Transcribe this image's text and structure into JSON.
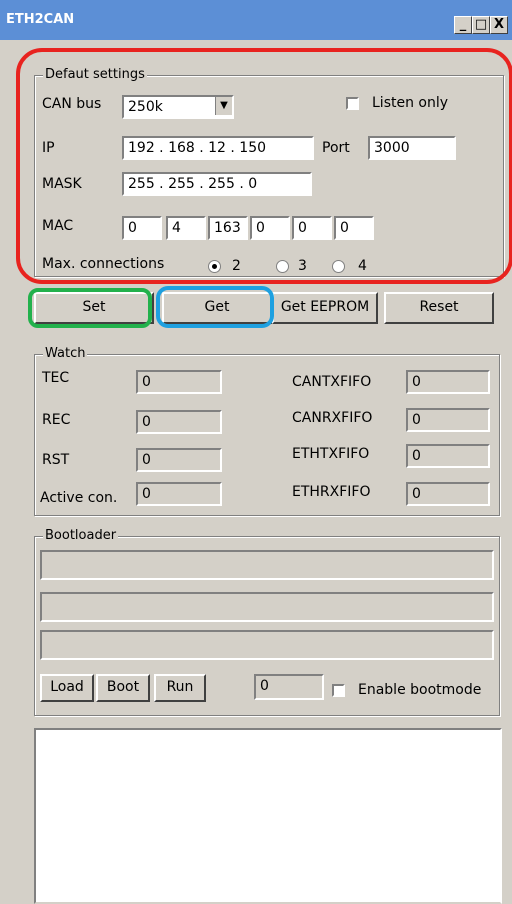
{
  "window": {
    "title": "ETH2CAN",
    "min_glyph": "_",
    "max_glyph": "□",
    "close_glyph": "X"
  },
  "defaults": {
    "group_label": "Defaut settings",
    "can_label": "CAN bus",
    "can_value": "250k",
    "listen_label": "Listen only",
    "ip_label": "IP",
    "ip_value": "192 . 168 .  12  . 150",
    "port_label": "Port",
    "port_value": "3000",
    "mask_label": "MASK",
    "mask_value": "255 . 255 . 255 .  0",
    "mac_label": "MAC",
    "mac": [
      "0",
      "4",
      "163",
      "0",
      "0",
      "0"
    ],
    "maxconn_label": "Max. connections",
    "radios": [
      "2",
      "3",
      "4"
    ],
    "selected": "2"
  },
  "buttons": {
    "set": "Set",
    "get": "Get",
    "eeprom": "Get EEPROM",
    "reset": "Reset"
  },
  "watch": {
    "group_label": "Watch",
    "left": [
      {
        "label": "TEC",
        "value": "0"
      },
      {
        "label": "REC",
        "value": "0"
      },
      {
        "label": "RST",
        "value": "0"
      },
      {
        "label": "Active con.",
        "value": "0"
      }
    ],
    "right": [
      {
        "label": "CANTXFIFO",
        "value": "0"
      },
      {
        "label": "CANRXFIFO",
        "value": "0"
      },
      {
        "label": "ETHTXFIFO",
        "value": "0"
      },
      {
        "label": "ETHRXFIFO",
        "value": "0"
      }
    ]
  },
  "bootloader": {
    "group_label": "Bootloader",
    "load": "Load",
    "boot": "Boot",
    "run": "Run",
    "value": "0",
    "enable_label": "Enable bootmode"
  },
  "colors": {
    "red": "#e8231f",
    "green": "#22b14c",
    "blue": "#1ea0e0"
  }
}
